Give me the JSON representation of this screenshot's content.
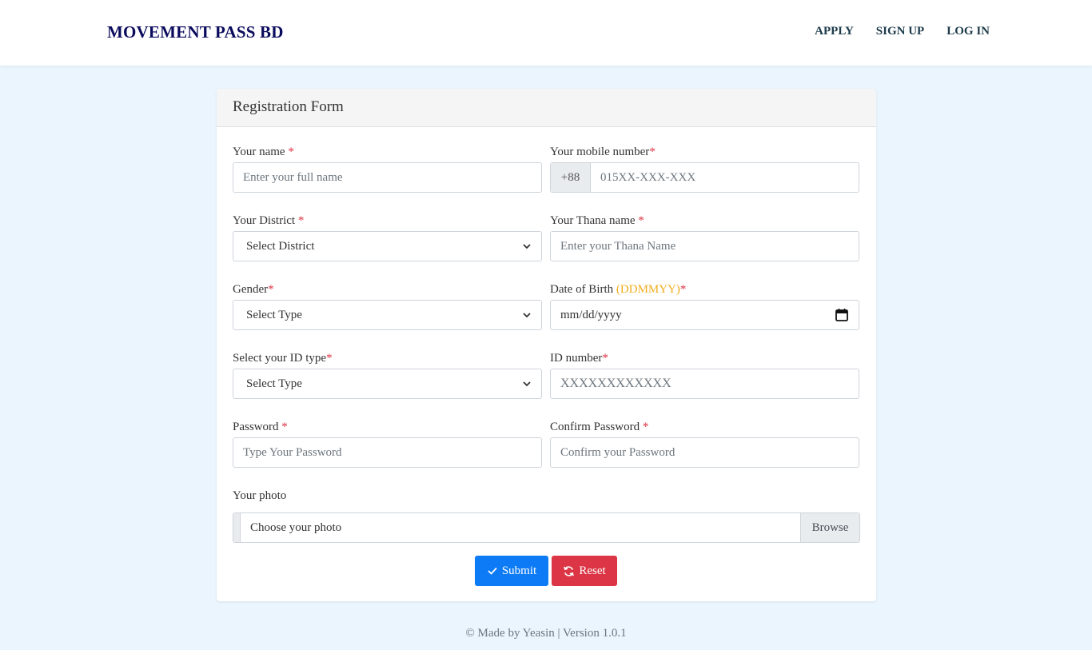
{
  "navbar": {
    "brand": "MOVEMENT PASS BD",
    "links": [
      "APPLY",
      "SIGN UP",
      "LOG IN"
    ]
  },
  "form": {
    "title": "Registration Form",
    "name": {
      "label": "Your name ",
      "required": "*",
      "placeholder": "Enter your full name"
    },
    "mobile": {
      "label": "Your mobile number",
      "required": "*",
      "prefix": "+88",
      "placeholder": "015XX-XXX-XXX"
    },
    "district": {
      "label": "Your District ",
      "required": "*",
      "selected": "Select District"
    },
    "thana": {
      "label": "Your Thana name ",
      "required": "*",
      "placeholder": "Enter your Thana Name"
    },
    "gender": {
      "label": "Gender",
      "required": "*",
      "selected": "Select Type"
    },
    "dob": {
      "label": "Date of Birth ",
      "hint": "(DDMMYY)",
      "required": "*",
      "placeholder": "mm/dd/yyyy"
    },
    "id_type": {
      "label": "Select your ID type",
      "required": "*",
      "selected": "Select Type"
    },
    "id_number": {
      "label": "ID number",
      "required": "*",
      "placeholder": "XXXXXXXXXXXX"
    },
    "password": {
      "label": "Password ",
      "required": "*",
      "placeholder": "Type Your Password"
    },
    "confirm_password": {
      "label": "Confirm Password ",
      "required": "*",
      "placeholder": "Confirm your Password"
    },
    "photo": {
      "label": "Your photo",
      "placeholder": "Choose your photo",
      "browse": "Browse"
    },
    "submit_label": "Submit",
    "reset_label": "Reset"
  },
  "footer": {
    "text": "© Made by Yeasin | Version 1.0.1"
  },
  "colors": {
    "primary": "#0d7bf5",
    "danger": "#dc3545",
    "brand": "#0b0b5e",
    "background": "#eaf5fd",
    "hint": "#f0ad1e"
  },
  "icons": {
    "submit": "check-icon",
    "reset": "refresh-icon",
    "select": "chevron-down-icon",
    "date": "calendar-icon"
  }
}
